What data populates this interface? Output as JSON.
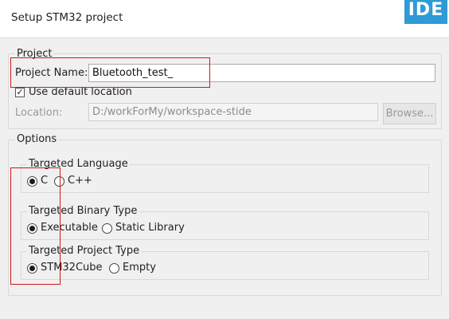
{
  "window": {
    "title": "Setup STM32 project",
    "logo_text": "IDE"
  },
  "project_group": {
    "label": "Project",
    "name_label": "Project Name:",
    "name_value": "Bluetooth_test_",
    "use_default_checked": true,
    "use_default_label": "Use default location",
    "location_label": "Location:",
    "location_value": "D:/workForMy/workspace-stide",
    "browse_label": "Browse..."
  },
  "options_group": {
    "label": "Options",
    "language": {
      "label": "Targeted Language",
      "options": [
        "C",
        "C++"
      ],
      "selected": "C"
    },
    "binary": {
      "label": "Targeted Binary Type",
      "options": [
        "Executable",
        "Static Library"
      ],
      "selected": "Executable"
    },
    "project_type": {
      "label": "Targeted Project Type",
      "options": [
        "STM32Cube",
        "Empty"
      ],
      "selected": "STM32Cube"
    }
  },
  "annotation_color": "#d01818"
}
